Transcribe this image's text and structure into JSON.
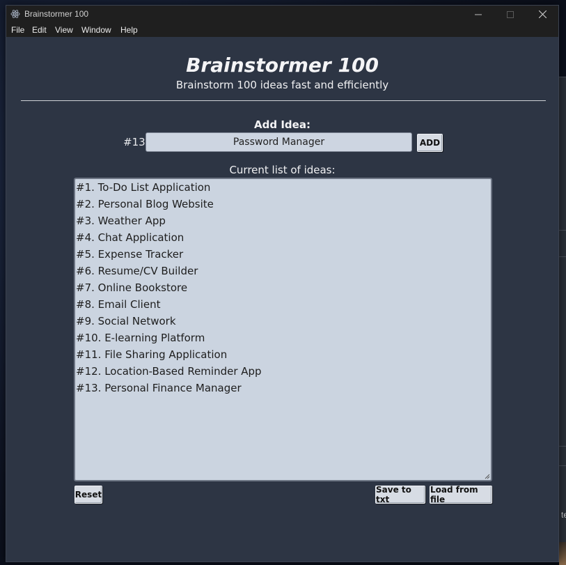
{
  "window": {
    "title": "Brainstormer 100"
  },
  "menu": [
    "File",
    "Edit",
    "View",
    "Window",
    "Help"
  ],
  "app": {
    "heading": "Brainstormer 100",
    "subtitle": "Brainstorm 100 ideas fast and efficiently"
  },
  "add_idea": {
    "label": "Add Idea:",
    "number": "#13",
    "input_value": "Password Manager",
    "add_button": "ADD"
  },
  "list": {
    "label": "Current list of ideas:",
    "items": [
      "#1. To-Do List Application",
      "#2. Personal Blog Website",
      "#3. Weather App",
      "#4. Chat Application",
      "#5. Expense Tracker",
      "#6. Resume/CV Builder",
      "#7. Online Bookstore",
      "#8. Email Client",
      "#9. Social Network",
      "#10. E-learning Platform",
      "#11. File Sharing Application",
      "#12. Location-Based Reminder App",
      "#13. Personal Finance Manager"
    ]
  },
  "buttons": {
    "reset": "Reset",
    "save": "Save to txt",
    "load": "Load from file"
  },
  "background": {
    "partial_text": "te"
  },
  "colors": {
    "app_background": "#2d3544",
    "input_background": "#cdd5e1",
    "titlebar": "#1f1f1f"
  }
}
